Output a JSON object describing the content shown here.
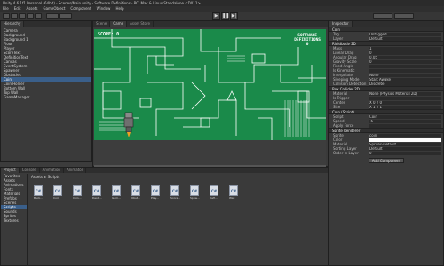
{
  "window": {
    "title": "Unity 4.6.1f1 Personal (64bit) - Scenes/Main.unity - Software Definitions - PC, Mac & Linux Standalone <DX11>"
  },
  "menu": [
    "File",
    "Edit",
    "Assets",
    "GameObject",
    "Component",
    "Window",
    "Help"
  ],
  "toolbar": {
    "play": "▶",
    "pause": "❚❚",
    "step": "▶|"
  },
  "tabs": {
    "hierarchy": "Hierarchy",
    "scene": "Scene",
    "game": "Game",
    "asset_store": "Asset Store",
    "inspector": "Inspector",
    "project": "Project",
    "console": "Console",
    "animation": "Animation",
    "animator": "Animator"
  },
  "hierarchy": {
    "items": [
      "Camera",
      "Background",
      "Background 1",
      "Floor",
      "Player",
      "ScoreText",
      "DefinitionText",
      "Canvas",
      "EventSystem",
      "Spawner",
      "Obstacles",
      "Coin",
      "Coin Holder",
      "Bottom Wall",
      "Top Wall",
      "GameManager"
    ],
    "selected_index": 11
  },
  "game": {
    "score_label": "SCORE: 0",
    "definition_title_1": "SOFTWARE",
    "definition_title_2": "DEFINITIONS",
    "definition_count": "0",
    "colors": {
      "board": "#1a8a4a",
      "lines": "#ffffff",
      "floor": "#3d3d3d"
    }
  },
  "inspector": {
    "object_name": "Coin",
    "rows": [
      {
        "label": "Tag",
        "value": "Untagged"
      },
      {
        "label": "Layer",
        "value": "Default"
      }
    ],
    "rigidbody_header": "Rigidbody 2D",
    "rigidbody_rows": [
      {
        "label": "Mass",
        "value": "1"
      },
      {
        "label": "Linear Drag",
        "value": "0"
      },
      {
        "label": "Angular Drag",
        "value": "0.05"
      },
      {
        "label": "Gravity Scale",
        "value": "0"
      },
      {
        "label": "Fixed Angle",
        "value": ""
      },
      {
        "label": "Is Kinematic",
        "value": ""
      },
      {
        "label": "Interpolate",
        "value": "None"
      },
      {
        "label": "Sleeping Mode",
        "value": "Start Awake"
      },
      {
        "label": "Collision Detection",
        "value": "Discrete"
      }
    ],
    "collider_header": "Box Collider 2D",
    "collider_rows": [
      {
        "label": "Material",
        "value": "None (Physics Material 2D)"
      },
      {
        "label": "Is Trigger",
        "value": ""
      },
      {
        "label": "Center",
        "value": "X 0   Y 0"
      },
      {
        "label": "Size",
        "value": "X 1   Y 1"
      }
    ],
    "script_header": "Coin (Script)",
    "script_rows": [
      {
        "label": "Script",
        "value": "Coin"
      },
      {
        "label": "Speed",
        "value": "-5"
      },
      {
        "label": "Apply Force",
        "value": ""
      }
    ],
    "sprite_header": "Sprite Renderer",
    "sprite_rows": [
      {
        "label": "Sprite",
        "value": "coin"
      },
      {
        "label": "Color",
        "value": ""
      },
      {
        "label": "Material",
        "value": "Sprites-Default"
      },
      {
        "label": "Sorting Layer",
        "value": "Default"
      },
      {
        "label": "Order in Layer",
        "value": "0"
      }
    ],
    "add_component": "Add Component"
  },
  "project": {
    "breadcrumb": "Assets ► Scripts",
    "folders": [
      "Favorites",
      "Assets",
      "Animations",
      "Fonts",
      "Materials",
      "Prefabs",
      "Scenes",
      "Scripts",
      "Sounds",
      "Sprites",
      "Textures"
    ],
    "selected_folder_index": 7,
    "assets": [
      "Back...",
      "Coin",
      "Coin...",
      "Destr...",
      "Gam...",
      "Obst...",
      "Play...",
      "Score...",
      "Spaw...",
      "Defi...",
      "Wall"
    ],
    "file_icon_label": "C#"
  }
}
